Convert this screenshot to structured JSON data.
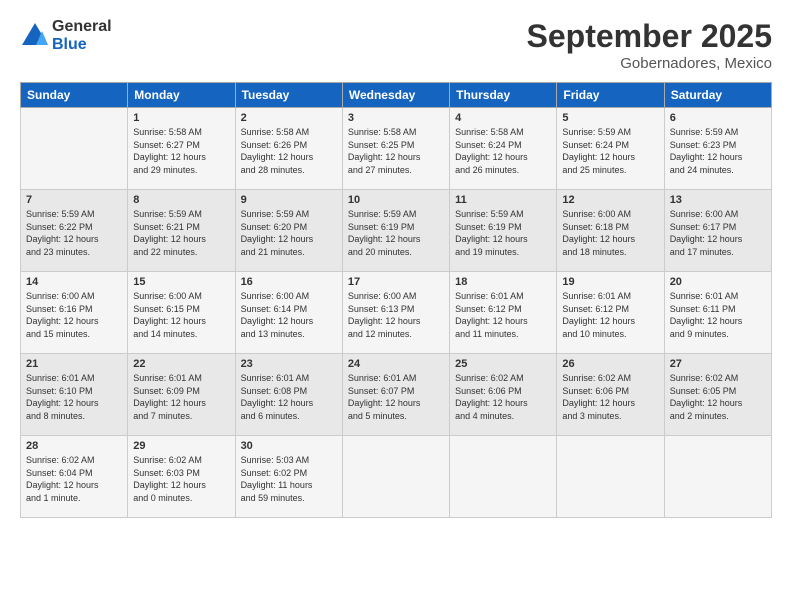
{
  "logo": {
    "general": "General",
    "blue": "Blue"
  },
  "header": {
    "month": "September 2025",
    "location": "Gobernadores, Mexico"
  },
  "days_of_week": [
    "Sunday",
    "Monday",
    "Tuesday",
    "Wednesday",
    "Thursday",
    "Friday",
    "Saturday"
  ],
  "weeks": [
    [
      {
        "day": "",
        "info": ""
      },
      {
        "day": "1",
        "info": "Sunrise: 5:58 AM\nSunset: 6:27 PM\nDaylight: 12 hours\nand 29 minutes."
      },
      {
        "day": "2",
        "info": "Sunrise: 5:58 AM\nSunset: 6:26 PM\nDaylight: 12 hours\nand 28 minutes."
      },
      {
        "day": "3",
        "info": "Sunrise: 5:58 AM\nSunset: 6:25 PM\nDaylight: 12 hours\nand 27 minutes."
      },
      {
        "day": "4",
        "info": "Sunrise: 5:58 AM\nSunset: 6:24 PM\nDaylight: 12 hours\nand 26 minutes."
      },
      {
        "day": "5",
        "info": "Sunrise: 5:59 AM\nSunset: 6:24 PM\nDaylight: 12 hours\nand 25 minutes."
      },
      {
        "day": "6",
        "info": "Sunrise: 5:59 AM\nSunset: 6:23 PM\nDaylight: 12 hours\nand 24 minutes."
      }
    ],
    [
      {
        "day": "7",
        "info": "Sunrise: 5:59 AM\nSunset: 6:22 PM\nDaylight: 12 hours\nand 23 minutes."
      },
      {
        "day": "8",
        "info": "Sunrise: 5:59 AM\nSunset: 6:21 PM\nDaylight: 12 hours\nand 22 minutes."
      },
      {
        "day": "9",
        "info": "Sunrise: 5:59 AM\nSunset: 6:20 PM\nDaylight: 12 hours\nand 21 minutes."
      },
      {
        "day": "10",
        "info": "Sunrise: 5:59 AM\nSunset: 6:19 PM\nDaylight: 12 hours\nand 20 minutes."
      },
      {
        "day": "11",
        "info": "Sunrise: 5:59 AM\nSunset: 6:19 PM\nDaylight: 12 hours\nand 19 minutes."
      },
      {
        "day": "12",
        "info": "Sunrise: 6:00 AM\nSunset: 6:18 PM\nDaylight: 12 hours\nand 18 minutes."
      },
      {
        "day": "13",
        "info": "Sunrise: 6:00 AM\nSunset: 6:17 PM\nDaylight: 12 hours\nand 17 minutes."
      }
    ],
    [
      {
        "day": "14",
        "info": "Sunrise: 6:00 AM\nSunset: 6:16 PM\nDaylight: 12 hours\nand 15 minutes."
      },
      {
        "day": "15",
        "info": "Sunrise: 6:00 AM\nSunset: 6:15 PM\nDaylight: 12 hours\nand 14 minutes."
      },
      {
        "day": "16",
        "info": "Sunrise: 6:00 AM\nSunset: 6:14 PM\nDaylight: 12 hours\nand 13 minutes."
      },
      {
        "day": "17",
        "info": "Sunrise: 6:00 AM\nSunset: 6:13 PM\nDaylight: 12 hours\nand 12 minutes."
      },
      {
        "day": "18",
        "info": "Sunrise: 6:01 AM\nSunset: 6:12 PM\nDaylight: 12 hours\nand 11 minutes."
      },
      {
        "day": "19",
        "info": "Sunrise: 6:01 AM\nSunset: 6:12 PM\nDaylight: 12 hours\nand 10 minutes."
      },
      {
        "day": "20",
        "info": "Sunrise: 6:01 AM\nSunset: 6:11 PM\nDaylight: 12 hours\nand 9 minutes."
      }
    ],
    [
      {
        "day": "21",
        "info": "Sunrise: 6:01 AM\nSunset: 6:10 PM\nDaylight: 12 hours\nand 8 minutes."
      },
      {
        "day": "22",
        "info": "Sunrise: 6:01 AM\nSunset: 6:09 PM\nDaylight: 12 hours\nand 7 minutes."
      },
      {
        "day": "23",
        "info": "Sunrise: 6:01 AM\nSunset: 6:08 PM\nDaylight: 12 hours\nand 6 minutes."
      },
      {
        "day": "24",
        "info": "Sunrise: 6:01 AM\nSunset: 6:07 PM\nDaylight: 12 hours\nand 5 minutes."
      },
      {
        "day": "25",
        "info": "Sunrise: 6:02 AM\nSunset: 6:06 PM\nDaylight: 12 hours\nand 4 minutes."
      },
      {
        "day": "26",
        "info": "Sunrise: 6:02 AM\nSunset: 6:06 PM\nDaylight: 12 hours\nand 3 minutes."
      },
      {
        "day": "27",
        "info": "Sunrise: 6:02 AM\nSunset: 6:05 PM\nDaylight: 12 hours\nand 2 minutes."
      }
    ],
    [
      {
        "day": "28",
        "info": "Sunrise: 6:02 AM\nSunset: 6:04 PM\nDaylight: 12 hours\nand 1 minute."
      },
      {
        "day": "29",
        "info": "Sunrise: 6:02 AM\nSunset: 6:03 PM\nDaylight: 12 hours\nand 0 minutes."
      },
      {
        "day": "30",
        "info": "Sunrise: 5:03 AM\nSunset: 6:02 PM\nDaylight: 11 hours\nand 59 minutes."
      },
      {
        "day": "",
        "info": ""
      },
      {
        "day": "",
        "info": ""
      },
      {
        "day": "",
        "info": ""
      },
      {
        "day": "",
        "info": ""
      }
    ]
  ]
}
